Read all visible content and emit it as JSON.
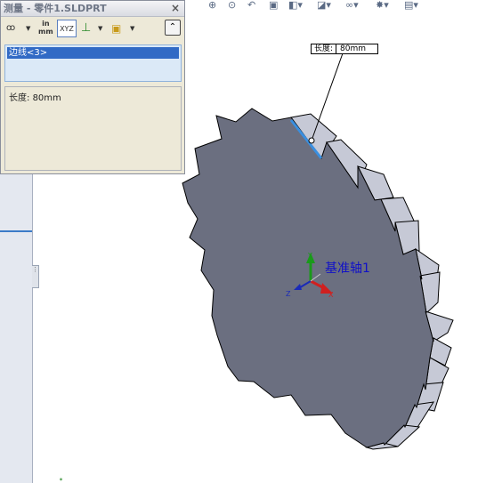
{
  "dialog": {
    "title": "测量 - 零件1.SLDPRT",
    "close_glyph": "×",
    "toolbar": {
      "arc_options_glyph": "ꝏ",
      "dropdown_glyph": "▼",
      "units_top": "in",
      "units_bottom": "mm",
      "xyz_label": "XYZ",
      "collapse_glyph": "⌃"
    },
    "selection": [
      "边线<3>"
    ],
    "result_label": "长度:",
    "result_value": "80mm"
  },
  "callout": {
    "label": "长度:",
    "value": "80mm"
  },
  "graphics": {
    "axis_name": "基准轴1"
  },
  "triad": {
    "x": "X",
    "y": "Y",
    "z": "Z"
  },
  "colors": {
    "gear_face": "#6b6f80",
    "gear_side": "#c6c9d6",
    "selected_edge": "#3a8fe0",
    "axis_text": "#1010c8"
  }
}
